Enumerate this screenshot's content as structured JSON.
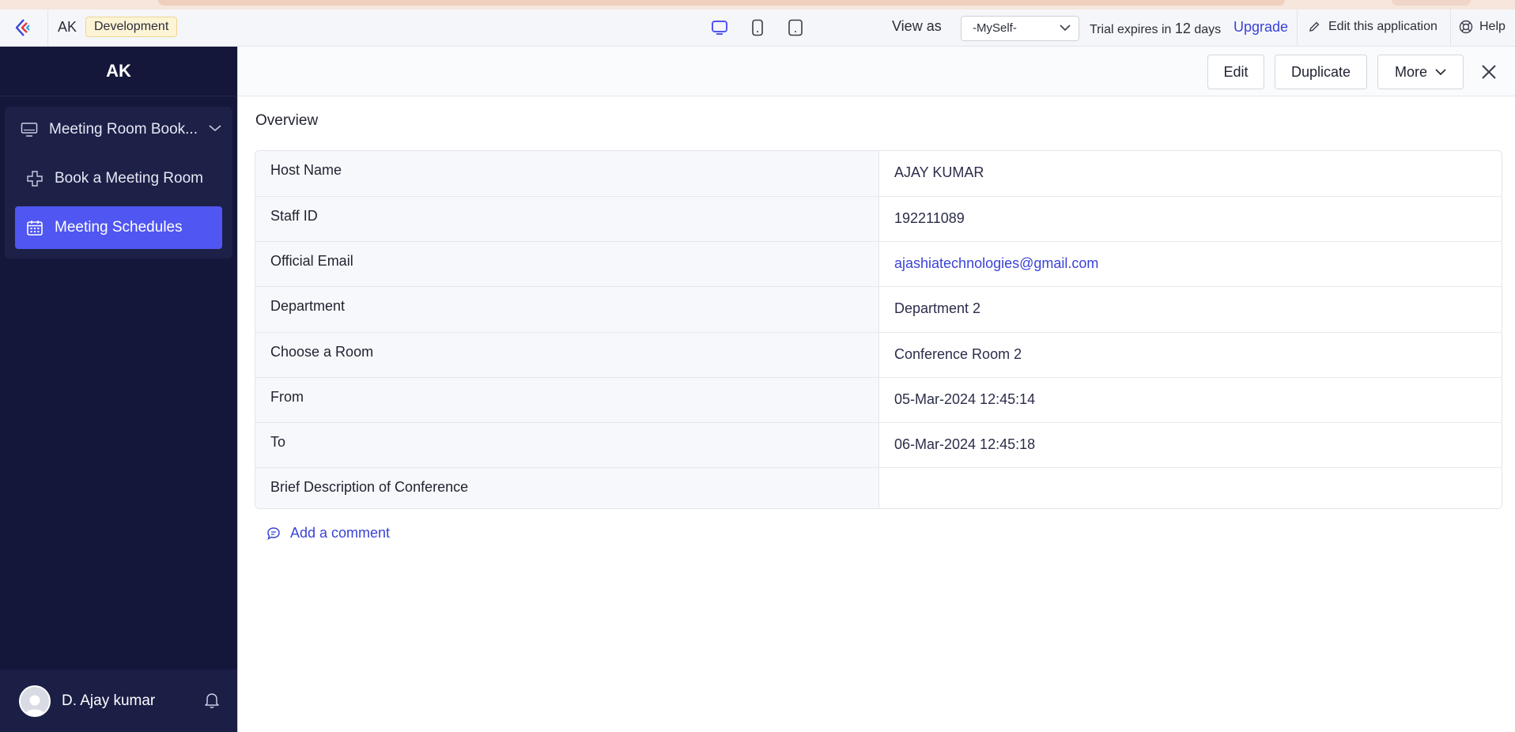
{
  "topbar": {
    "app_abbr": "AK",
    "env_badge": "Development",
    "view_as_label": "View as",
    "view_as_value": "-MySelf-",
    "trial_prefix": "Trial expires in",
    "trial_days": "12",
    "trial_suffix": "days",
    "upgrade": "Upgrade",
    "edit_app": "Edit this application",
    "help": "Help",
    "devices": [
      "desktop-icon",
      "tablet-icon",
      "mobile-icon"
    ]
  },
  "sidebar": {
    "title": "AK",
    "group_label": "Meeting Room Book...",
    "items": [
      {
        "label": "Book a Meeting Room",
        "icon": "plus-icon"
      },
      {
        "label": "Meeting Schedules",
        "icon": "calendar-icon",
        "active": true
      }
    ],
    "user_name": "D. Ajay kumar"
  },
  "toolbar": {
    "edit": "Edit",
    "duplicate": "Duplicate",
    "more": "More"
  },
  "record": {
    "section_title": "Overview",
    "fields": [
      {
        "label": "Host Name",
        "value": "AJAY KUMAR"
      },
      {
        "label": "Staff ID",
        "value": "192211089"
      },
      {
        "label": "Official Email",
        "value": "ajashiatechnologies@gmail.com"
      },
      {
        "label": "Department",
        "value": "Department 2"
      },
      {
        "label": "Choose a Room",
        "value": "Conference Room 2"
      },
      {
        "label": "From",
        "value": "05-Mar-2024 12:45:14"
      },
      {
        "label": "To",
        "value": "06-Mar-2024 12:45:18"
      },
      {
        "label": "Brief Description of Conference",
        "value": ""
      }
    ],
    "add_comment": "Add a comment"
  },
  "colors": {
    "accent": "#4f56f2",
    "link": "#3a43d6",
    "sidebar_bg": "#15173a"
  }
}
